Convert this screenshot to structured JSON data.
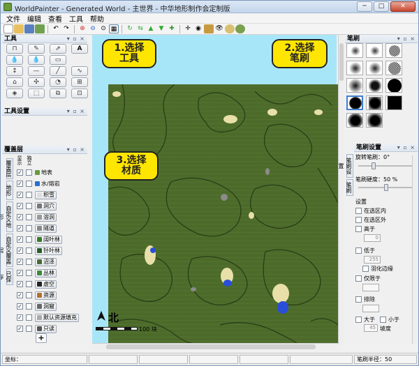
{
  "window": {
    "title": "WorldPainter - Generated World - 主世界 - 中华地形制作会定制版",
    "buttons": {
      "minimize": "─",
      "maximize": "□",
      "close": "✕"
    }
  },
  "menu": [
    "文件",
    "编辑",
    "查看",
    "工具",
    "帮助"
  ],
  "panels": {
    "tools": {
      "title": "工具",
      "controls": "▾ ▫ ×"
    },
    "tool_settings": {
      "title": "工具设置",
      "controls": "▾ ▫ ×"
    },
    "layers": {
      "title": "覆盖层",
      "controls": "▾ ▫ ×"
    },
    "brushes": {
      "title": "笔刷",
      "controls": "▾ ▫ ×"
    },
    "brush_settings": {
      "title": "笔刷设置",
      "controls": "▾ ▫ ×"
    }
  },
  "side_tabs_left": [
    "覆盖层",
    "地形",
    "自定义地形",
    "自定义覆盖层",
    "已保存"
  ],
  "side_tabs_right": [
    "笔刷设置",
    "笔刷"
  ],
  "layers": {
    "column_headers": [
      "显示",
      "独立"
    ],
    "items": [
      {
        "label": "地表",
        "icon": "grass-block-icon",
        "kind": "plain"
      },
      {
        "label": "水/熔岩",
        "icon": "water-drop-icon",
        "kind": "plain"
      },
      {
        "label": "积雪",
        "icon": "snow-icon",
        "kind": "button"
      },
      {
        "label": "洞穴",
        "icon": "cave-icon",
        "kind": "button"
      },
      {
        "label": "溶洞",
        "icon": "cavern-icon",
        "kind": "button"
      },
      {
        "label": "隧道",
        "icon": "tunnel-icon",
        "kind": "button"
      },
      {
        "label": "阔叶林",
        "icon": "deciduous-tree-icon",
        "kind": "button"
      },
      {
        "label": "针叶林",
        "icon": "pine-tree-icon",
        "kind": "button"
      },
      {
        "label": "沼泽",
        "icon": "swamp-icon",
        "kind": "button"
      },
      {
        "label": "丛林",
        "icon": "jungle-icon",
        "kind": "button"
      },
      {
        "label": "虚空",
        "icon": "void-icon",
        "kind": "button"
      },
      {
        "label": "资源",
        "icon": "resources-icon",
        "kind": "button"
      },
      {
        "label": "洞窟",
        "icon": "chasm-icon",
        "kind": "button"
      },
      {
        "label": "默认资源填充",
        "icon": "fill-icon",
        "kind": "button"
      },
      {
        "label": "只读",
        "icon": "lock-icon",
        "kind": "button"
      }
    ],
    "add_label": "+"
  },
  "brush_settings": {
    "rotation": "旋转笔刷：0°",
    "hardness": "笔刷硬度：50 %",
    "rotation_level": 0.25,
    "hardness_level": 0.5,
    "section": "设置",
    "in_selection": "在选区内",
    "out_selection": "在选区外",
    "above": "高于",
    "above_value": "0",
    "below": "低于",
    "below_value": "255",
    "feather": "羽化边缘",
    "only_on": "仅限于",
    "exclude": "排除",
    "greater": "大于",
    "less": "小于",
    "slope_value": "45",
    "slope_unit": "坡度"
  },
  "map": {
    "north_label": "北",
    "scale_label": "100 块"
  },
  "annotations": [
    {
      "text": "1.选择\n工具"
    },
    {
      "text": "2.选择\n笔刷"
    },
    {
      "text": "3.选择\n材质"
    }
  ],
  "status": {
    "coords": "坐标：",
    "brush_radius": "笔刷半径：50"
  },
  "colors": {
    "land": "#4c6b2b",
    "contour": "#2a3d16",
    "sand": "#e8e0a8",
    "water": "#2a4ed8",
    "bubble": "#ffe600",
    "mapbg": "#a7e6f8"
  }
}
